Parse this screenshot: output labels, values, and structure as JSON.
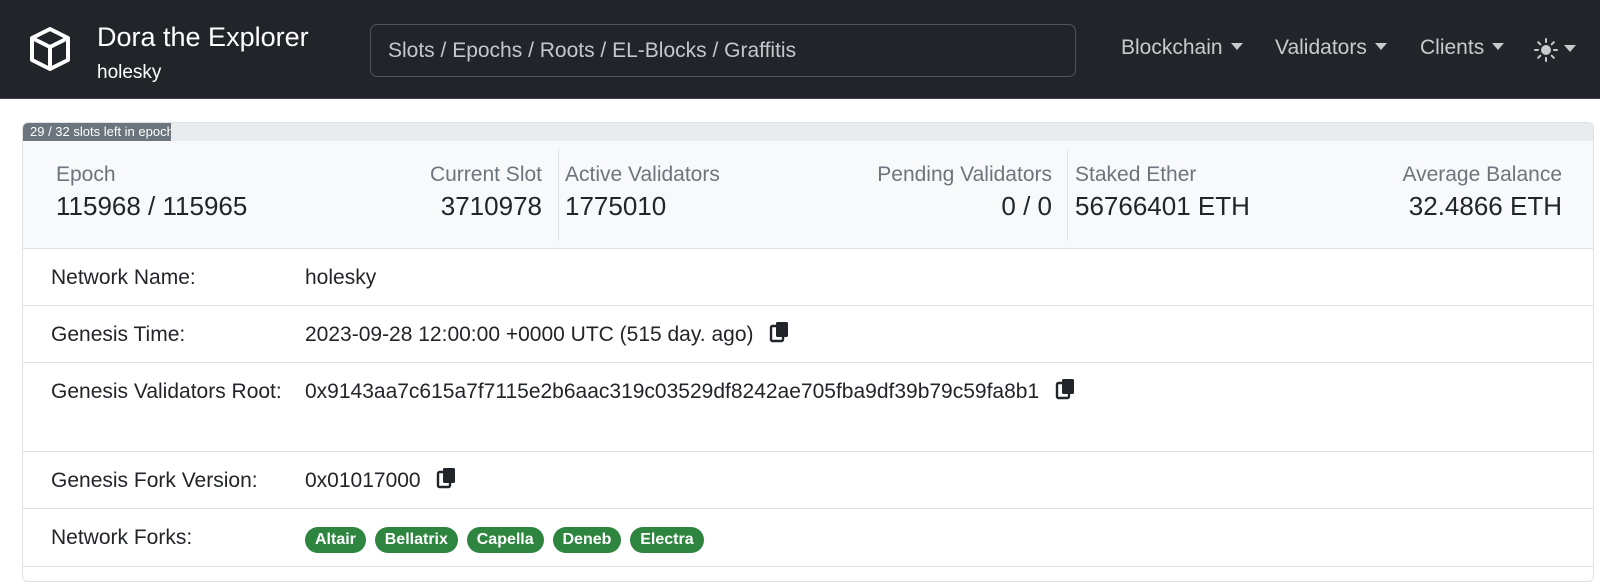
{
  "brand": {
    "title": "Dora the Explorer",
    "network": "holesky"
  },
  "search": {
    "placeholder": "Slots / Epochs / Roots / EL-Blocks / Graffitis"
  },
  "nav": {
    "blockchain": "Blockchain",
    "validators": "Validators",
    "clients": "Clients",
    "theme_icon": "sun-icon"
  },
  "progress": {
    "text": "29 / 32 slots left in epoch",
    "fraction": 0.094
  },
  "stats": {
    "epoch_label": "Epoch",
    "epoch_value": "115968 / 115965",
    "slot_label": "Current Slot",
    "slot_value": "3710978",
    "active_label": "Active Validators",
    "active_value": "1775010",
    "pending_label": "Pending Validators",
    "pending_value": "0 / 0",
    "staked_label": "Staked Ether",
    "staked_value": "56766401 ETH",
    "avg_label": "Average Balance",
    "avg_value": "32.4866 ETH"
  },
  "details": {
    "network_name_label": "Network Name:",
    "network_name": "holesky",
    "genesis_time_label": "Genesis Time:",
    "genesis_time": "2023-09-28 12:00:00 +0000 UTC (515 day. ago)",
    "genesis_root_label": "Genesis Validators Root:",
    "genesis_root": "0x9143aa7c615a7f7115e2b6aac319c03529df8242ae705fba9df39b79c59fa8b1",
    "fork_version_label": "Genesis Fork Version:",
    "fork_version": "0x01017000",
    "forks_label": "Network Forks:",
    "forks": [
      "Altair",
      "Bellatrix",
      "Capella",
      "Deneb",
      "Electra"
    ]
  },
  "colors": {
    "navbar": "#212529",
    "badge": "#2e8540",
    "muted": "#6c757d"
  }
}
